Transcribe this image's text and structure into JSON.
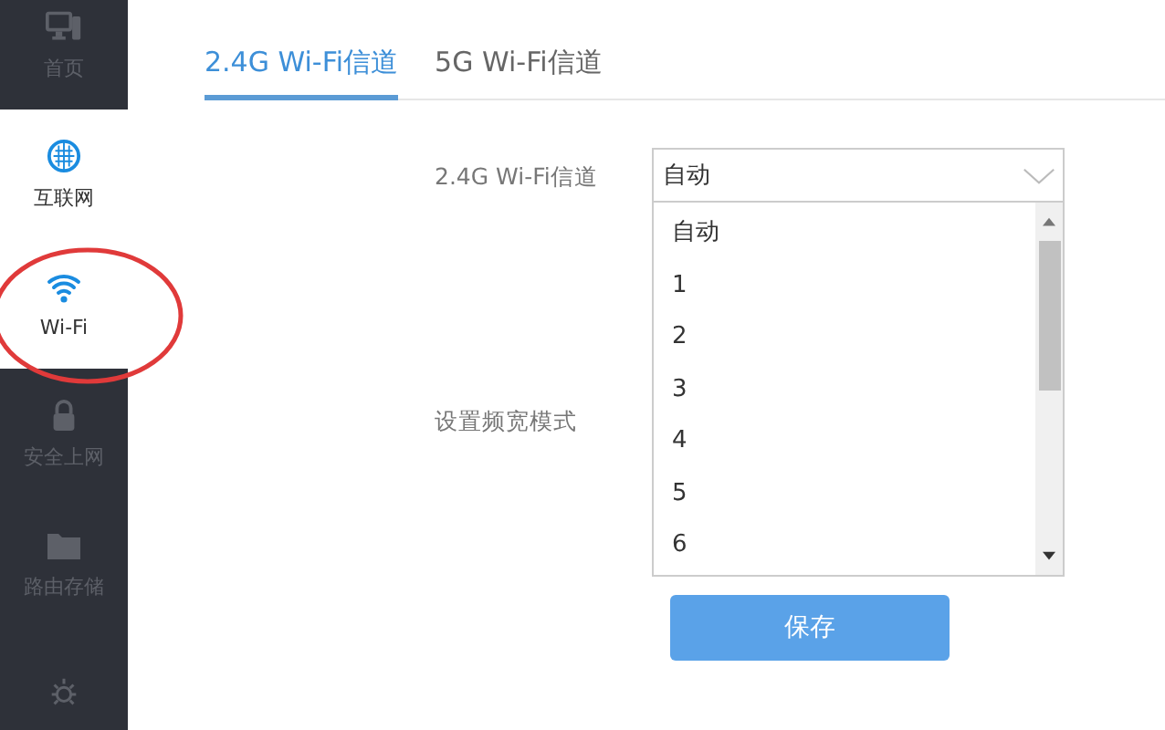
{
  "sidebar": {
    "items": [
      {
        "kind": "monitor",
        "label": "首页",
        "selected": false,
        "hovered": false
      },
      {
        "kind": "globe",
        "label": "互联网",
        "selected": false,
        "hovered": true
      },
      {
        "kind": "wifi",
        "label": "Wi-Fi",
        "selected": true,
        "hovered": false
      },
      {
        "kind": "lock",
        "label": "安全上网",
        "selected": false,
        "hovered": false
      },
      {
        "kind": "folder",
        "label": "路由存储",
        "selected": false,
        "hovered": false
      },
      {
        "kind": "sun",
        "selected": false,
        "hovered": false
      }
    ]
  },
  "annotation": {
    "kind": "circle"
  },
  "tabs": [
    {
      "label": "2.4G Wi-Fi信道",
      "selected": true
    },
    {
      "label": "5G Wi-Fi信道",
      "selected": false
    }
  ],
  "form": {
    "channel_label": "2.4G Wi-Fi信道",
    "channel_value": "自动",
    "bandwidth_label": "设置频宽模式",
    "options": [
      "自动",
      "1",
      "2",
      "3",
      "4",
      "5",
      "6"
    ]
  },
  "save_button": "保存"
}
